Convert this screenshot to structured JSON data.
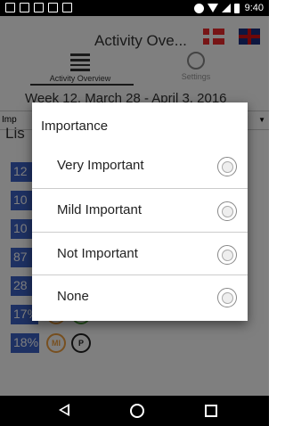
{
  "status_bar": {
    "time": "9:40"
  },
  "app": {
    "title": "Activity Ove...",
    "tabs": [
      {
        "label": "Activity Overview",
        "icon": "list-icon",
        "active": true
      },
      {
        "label": "Settings",
        "icon": "gear-icon",
        "active": false
      }
    ]
  },
  "background": {
    "week_label": "Week 12, March 28 - April 3, 2016",
    "filter_label": "Imp",
    "list_title": "Lis",
    "rows": [
      {
        "percent": "12",
        "fill": 0.12,
        "circles": []
      },
      {
        "percent": "10",
        "fill": 0.1,
        "circles": []
      },
      {
        "percent": "10",
        "fill": 0.1,
        "circles": []
      },
      {
        "percent": "87",
        "fill": 0.87,
        "circles": []
      },
      {
        "percent": "28",
        "fill": 0.28,
        "circles": []
      },
      {
        "percent": "17%",
        "fill": 0.17,
        "circles": [
          {
            "text": "MI",
            "color": "#f0a040"
          },
          {
            "text": "D",
            "color": "#4ca83a"
          }
        ]
      },
      {
        "percent": "18%",
        "fill": 0.18,
        "circles": [
          {
            "text": "MI",
            "color": "#f0a040"
          },
          {
            "text": "P",
            "color": "#222222"
          }
        ]
      }
    ]
  },
  "dialog": {
    "title": "Importance",
    "options": [
      {
        "label": "Very Important"
      },
      {
        "label": "Mild Important"
      },
      {
        "label": "Not Important"
      },
      {
        "label": "None"
      }
    ]
  },
  "colors": {
    "bar": "#3d63c7",
    "scrim": "rgba(0,0,0,0.5)"
  }
}
